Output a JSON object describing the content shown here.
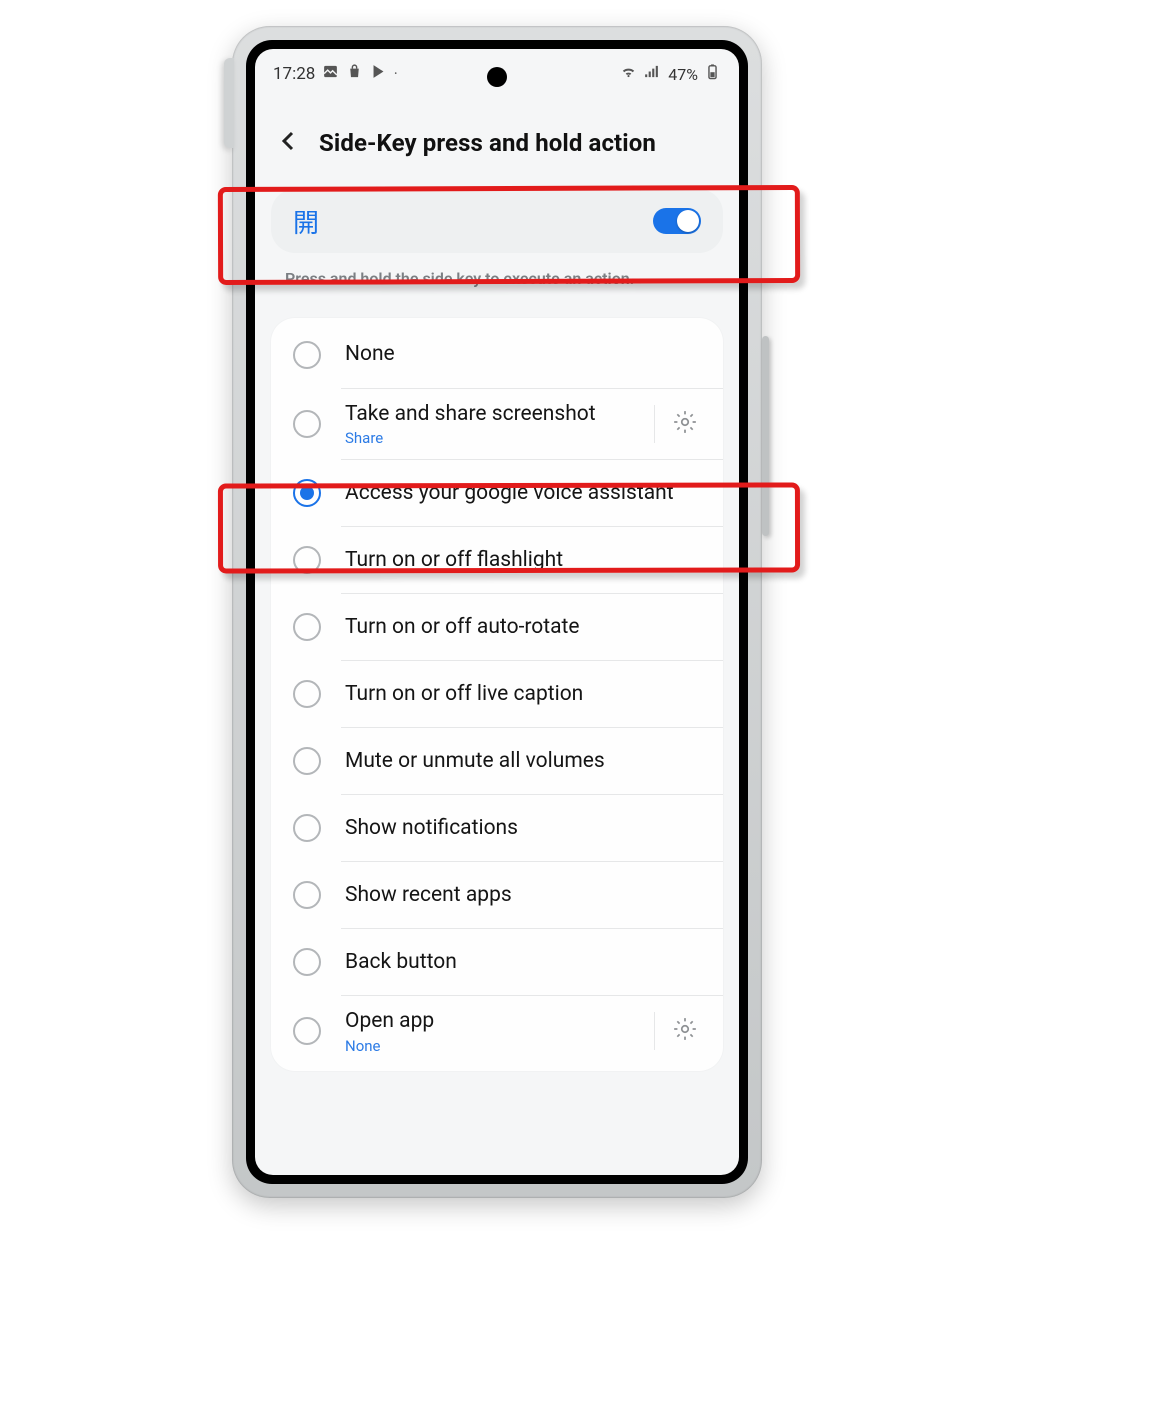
{
  "status_bar": {
    "time": "17:28",
    "battery_text": "47%"
  },
  "header": {
    "title": "Side-Key press and hold action"
  },
  "toggle": {
    "label": "開",
    "on": true
  },
  "hint": "Press and hold the side key to execute an action.",
  "options": [
    {
      "label": "None",
      "sub": null,
      "selected": false,
      "gear": false
    },
    {
      "label": "Take and share screenshot",
      "sub": "Share",
      "selected": false,
      "gear": true
    },
    {
      "label": "Access your google voice assistant",
      "sub": null,
      "selected": true,
      "gear": false
    },
    {
      "label": "Turn on or off flashlight",
      "sub": null,
      "selected": false,
      "gear": false
    },
    {
      "label": "Turn on or off auto-rotate",
      "sub": null,
      "selected": false,
      "gear": false
    },
    {
      "label": "Turn on or off live caption",
      "sub": null,
      "selected": false,
      "gear": false
    },
    {
      "label": "Mute or unmute all volumes",
      "sub": null,
      "selected": false,
      "gear": false
    },
    {
      "label": "Show notifications",
      "sub": null,
      "selected": false,
      "gear": false
    },
    {
      "label": "Show recent apps",
      "sub": null,
      "selected": false,
      "gear": false
    },
    {
      "label": "Back button",
      "sub": null,
      "selected": false,
      "gear": false
    },
    {
      "label": "Open app",
      "sub": "None",
      "selected": false,
      "gear": true
    }
  ]
}
